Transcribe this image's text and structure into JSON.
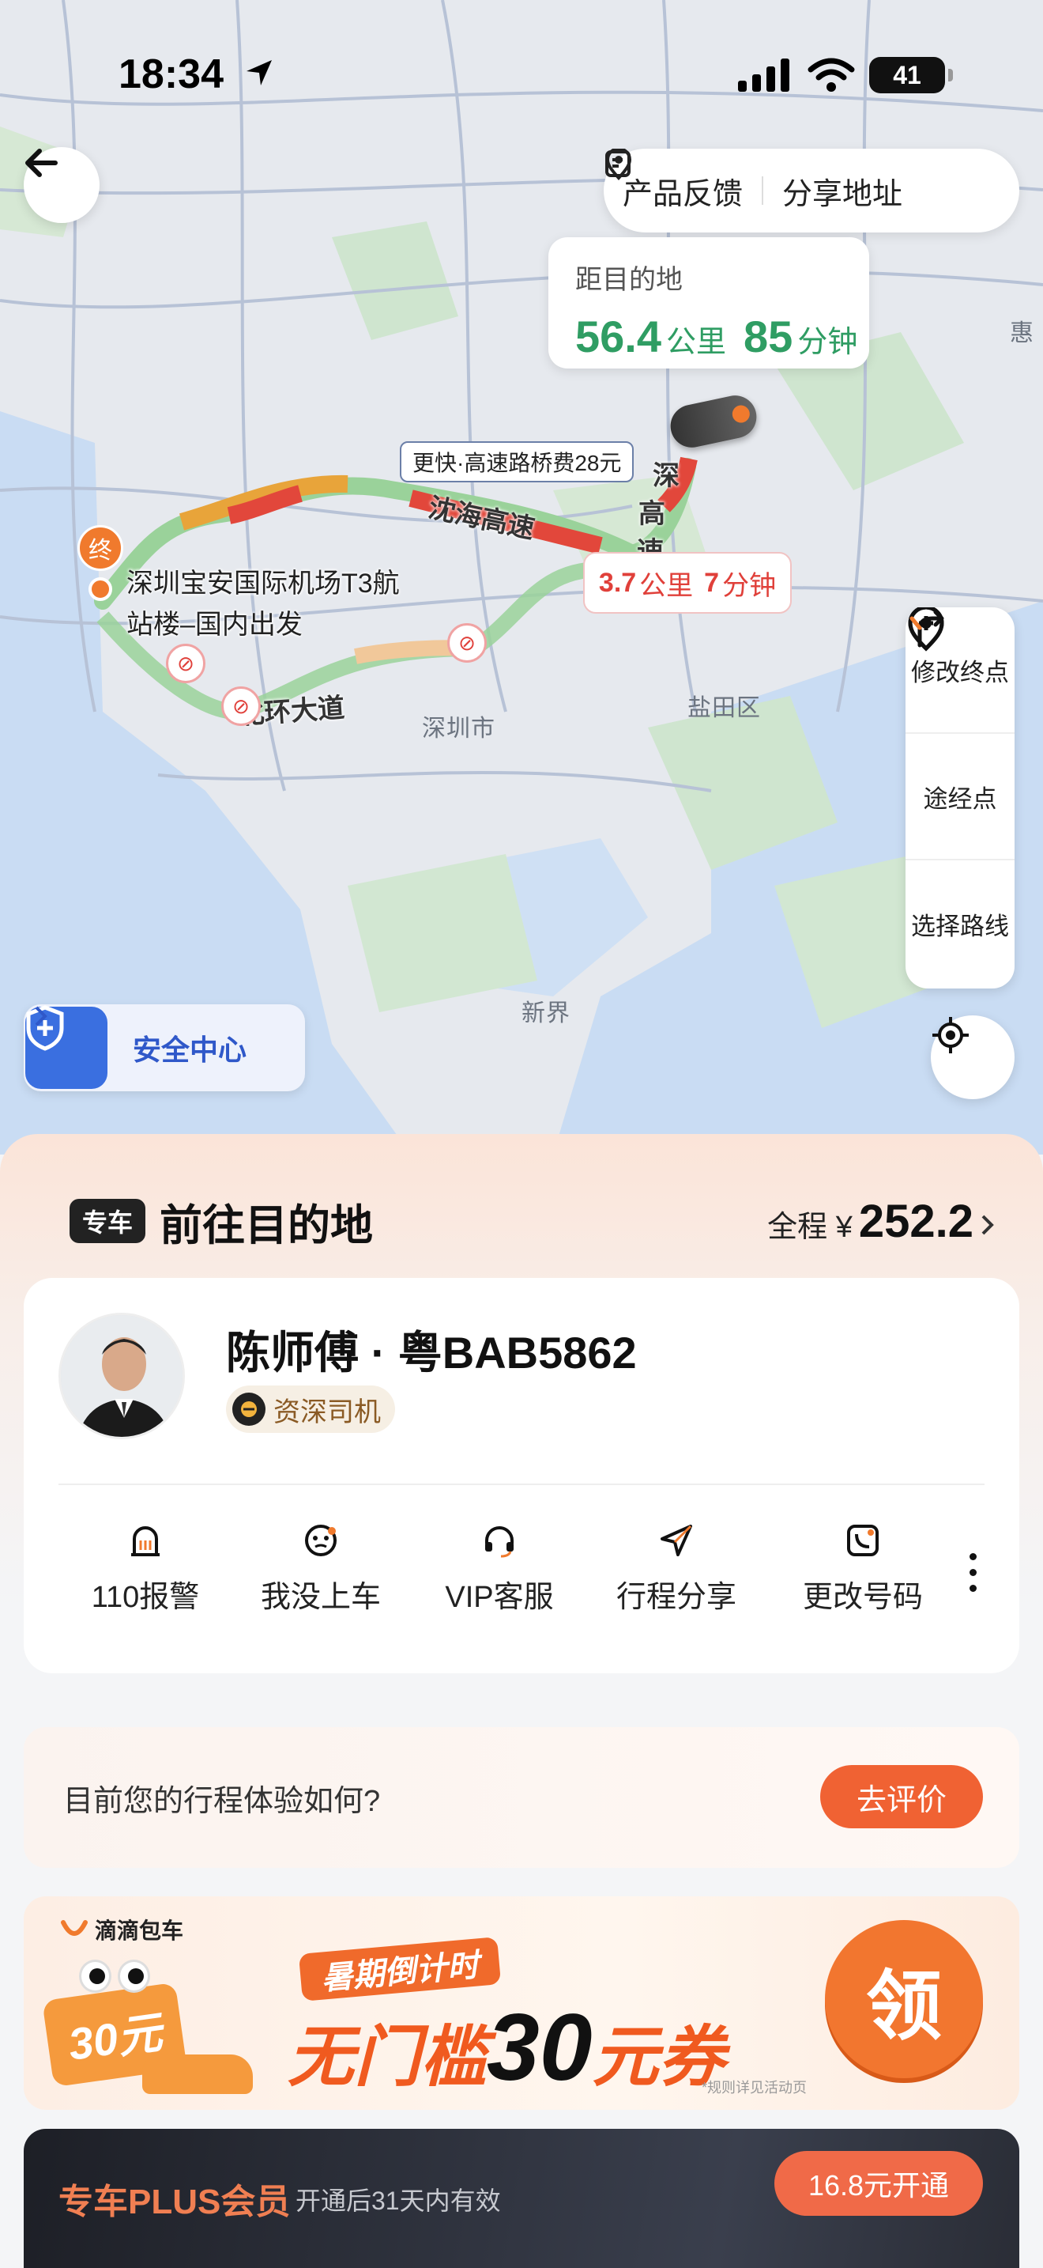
{
  "status_bar": {
    "time": "18:34",
    "battery": "41"
  },
  "map": {
    "top_pill": {
      "feedback": "产品反馈",
      "share": "分享地址"
    },
    "distance": {
      "label": "距目的地",
      "km": "56.4",
      "km_unit": "公里",
      "min": "85",
      "min_unit": "分钟"
    },
    "fast_route_tag": "更快·高速路桥费28元",
    "segment_tag": {
      "km": "3.7",
      "km_unit": "公里",
      "min": "7",
      "min_unit": "分钟"
    },
    "end_marker": "终",
    "origin_label_line1": "深圳宝安国际机场T3航",
    "origin_label_line2": "站楼–国内出发",
    "labels": {
      "road_shenhai": "沈海高速",
      "road_shen_1": "深",
      "road_shen_2": "高",
      "road_shen_3": "速",
      "road_beihuan": "北环大道",
      "city": "深圳市",
      "district_yantian": "盐田区",
      "district_xinjie": "新界",
      "hui": "惠"
    },
    "right_panel": {
      "modify_dest": "修改终点",
      "waypoint": "途经点",
      "choose_route": "选择路线"
    },
    "safety_center": "安全中心"
  },
  "colors": {
    "accent_orange": "#f06233",
    "green": "#2f9d63",
    "red": "#e0403a",
    "blue": "#3a6fe0"
  },
  "sheet": {
    "badge": "专车",
    "title": "前往目的地",
    "price_label": "全程 ¥",
    "price_value": "252.2",
    "driver": {
      "name": "陈师傅 · 粤BAB5862",
      "badge": "资深司机"
    },
    "actions": [
      {
        "label": "110报警",
        "icon": "alarm-110-icon"
      },
      {
        "label": "我没上车",
        "icon": "not-boarded-icon"
      },
      {
        "label": "VIP客服",
        "icon": "headset-icon"
      },
      {
        "label": "行程分享",
        "icon": "share-trip-icon"
      },
      {
        "label": "更改号码",
        "icon": "change-number-icon"
      }
    ],
    "rating": {
      "question": "目前您的行程体验如何?",
      "button": "去评价"
    },
    "banner": {
      "brand": "滴滴包车",
      "tag": "暑期倒计时",
      "headline_pre": "无门槛",
      "headline_num": "30",
      "headline_post": "元券",
      "ticket": "30元",
      "fine_print": "*规则详见活动页",
      "claim": "领"
    },
    "plus": {
      "title": "专车PLUS会员",
      "subtitle": "开通后31天内有效",
      "button": "16.8元开通"
    }
  }
}
